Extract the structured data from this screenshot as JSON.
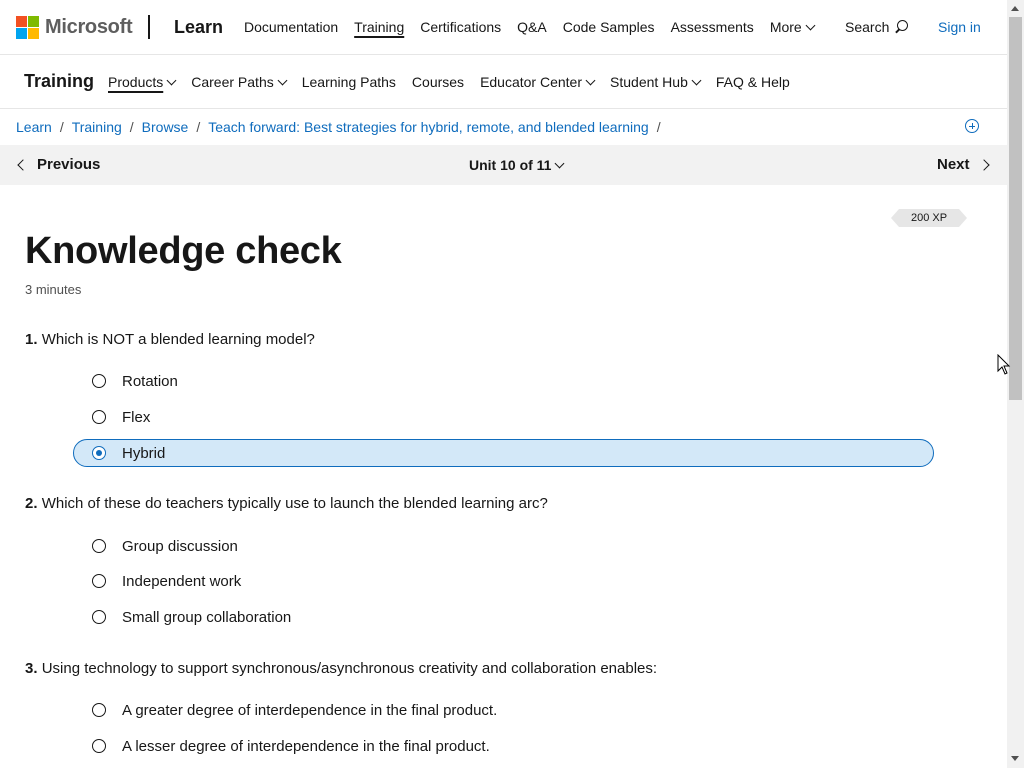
{
  "brand": {
    "company": "Microsoft",
    "product": "Learn",
    "logo_colors": [
      "#f25022",
      "#7fba00",
      "#00a4ef",
      "#ffb900"
    ]
  },
  "topnav": {
    "items": [
      {
        "label": "Documentation"
      },
      {
        "label": "Training",
        "active": true
      },
      {
        "label": "Certifications"
      },
      {
        "label": "Q&A"
      },
      {
        "label": "Code Samples"
      },
      {
        "label": "Assessments"
      },
      {
        "label": "More",
        "dropdown": true
      }
    ],
    "search_label": "Search",
    "signin_label": "Sign in"
  },
  "training_nav": {
    "title": "Training",
    "items": [
      {
        "label": "Products",
        "dropdown": true,
        "active": true
      },
      {
        "label": "Career Paths",
        "dropdown": true
      },
      {
        "label": "Learning Paths"
      },
      {
        "label": "Courses"
      },
      {
        "label": "Educator Center",
        "dropdown": true
      },
      {
        "label": "Student Hub",
        "dropdown": true
      },
      {
        "label": "FAQ & Help"
      }
    ]
  },
  "breadcrumb": [
    "Learn",
    "Training",
    "Browse",
    "Teach forward: Best strategies for hybrid, remote, and blended learning"
  ],
  "unit_nav": {
    "previous_label": "Previous",
    "unit_label": "Unit 10 of 11",
    "next_label": "Next"
  },
  "xp_badge": "200 XP",
  "page": {
    "title": "Knowledge check",
    "duration": "3 minutes"
  },
  "questions": [
    {
      "number": "1.",
      "text": "Which is NOT a blended learning model?",
      "options": [
        "Rotation",
        "Flex",
        "Hybrid"
      ],
      "selected": 2
    },
    {
      "number": "2.",
      "text": "Which of these do teachers typically use to launch the blended learning arc?",
      "options": [
        "Group discussion",
        "Independent work",
        "Small group collaboration"
      ],
      "selected": null
    },
    {
      "number": "3.",
      "text": "Using technology to support synchronous/asynchronous creativity and collaboration enables:",
      "options": [
        "A greater degree of interdependence in the final product.",
        "A lesser degree of interdependence in the final product."
      ],
      "selected": null
    }
  ],
  "colors": {
    "link": "#0f6cbd",
    "selected_bg": "#d3e8f8",
    "unit_bar_bg": "#f2f2f2"
  }
}
